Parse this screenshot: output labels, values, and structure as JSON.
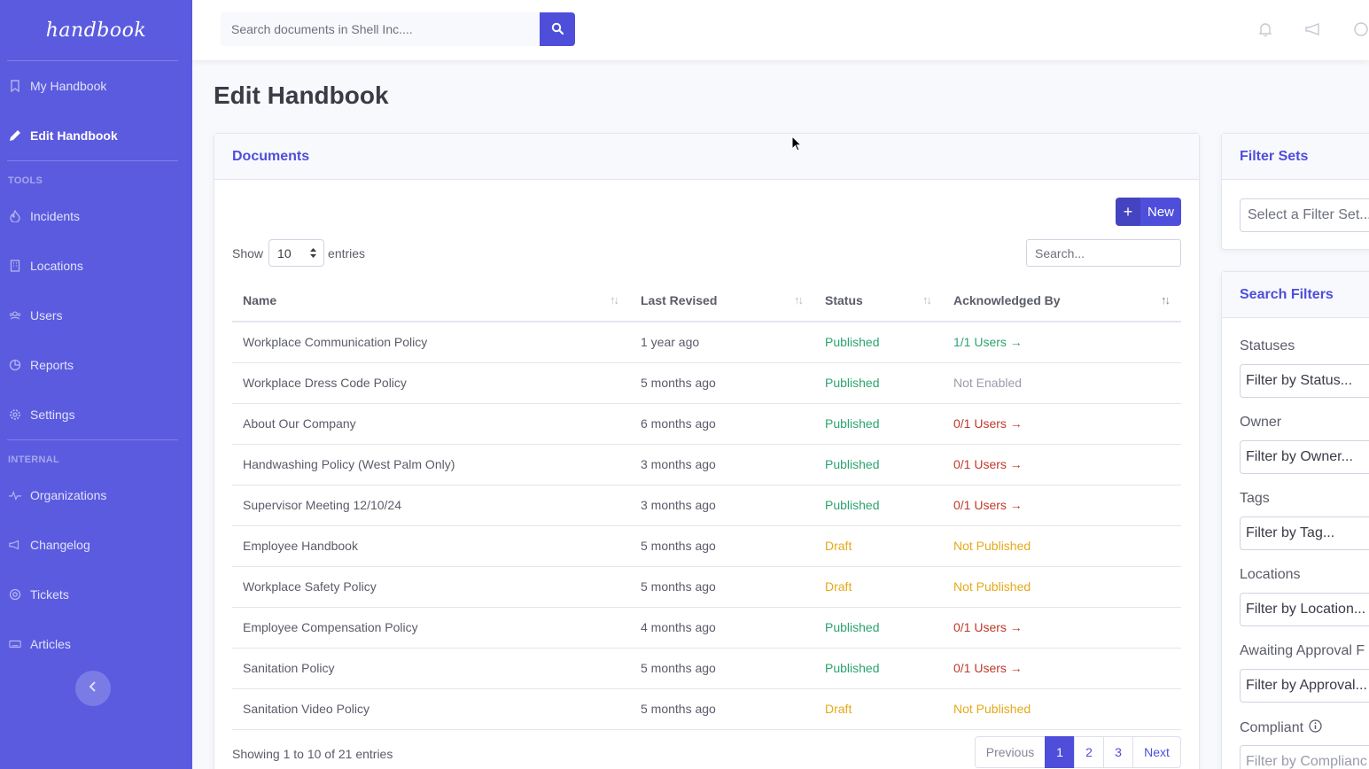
{
  "sidebar": {
    "brand": "handbook",
    "items": [
      {
        "label": "My Handbook",
        "icon": "bookmark-icon"
      },
      {
        "label": "Edit Handbook",
        "icon": "pencil-icon"
      }
    ],
    "tools_heading": "TOOLS",
    "tools": [
      {
        "label": "Incidents",
        "icon": "fire-icon"
      },
      {
        "label": "Locations",
        "icon": "building-icon"
      },
      {
        "label": "Users",
        "icon": "users-icon"
      },
      {
        "label": "Reports",
        "icon": "chart-pie-icon"
      },
      {
        "label": "Settings",
        "icon": "gear-icon"
      }
    ],
    "internal_heading": "INTERNAL",
    "internal": [
      {
        "label": "Organizations",
        "icon": "heartbeat-icon"
      },
      {
        "label": "Changelog",
        "icon": "megaphone-icon"
      },
      {
        "label": "Tickets",
        "icon": "lifebuoy-icon"
      },
      {
        "label": "Articles",
        "icon": "keyboard-icon"
      }
    ]
  },
  "topbar": {
    "search_placeholder": "Search documents in Shell Inc...."
  },
  "page": {
    "title": "Edit Handbook"
  },
  "documents": {
    "header": "Documents",
    "new_label": "New",
    "show_label": "Show",
    "entries_value": "10",
    "entries_label": "entries",
    "search_placeholder": "Search...",
    "columns": [
      "Name",
      "Last Revised",
      "Status",
      "Acknowledged By"
    ],
    "rows": [
      {
        "name": "Workplace Communication Policy",
        "revised": "1 year ago",
        "status": "Published",
        "ack": "1/1 Users →"
      },
      {
        "name": "Workplace Dress Code Policy",
        "revised": "5 months ago",
        "status": "Published",
        "ack": "Not Enabled"
      },
      {
        "name": "About Our Company",
        "revised": "6 months ago",
        "status": "Published",
        "ack": "0/1 Users →"
      },
      {
        "name": "Handwashing Policy (West Palm Only)",
        "revised": "3 months ago",
        "status": "Published",
        "ack": "0/1 Users →"
      },
      {
        "name": "Supervisor Meeting 12/10/24",
        "revised": "3 months ago",
        "status": "Published",
        "ack": "0/1 Users →"
      },
      {
        "name": "Employee Handbook",
        "revised": "5 months ago",
        "status": "Draft",
        "ack": "Not Published"
      },
      {
        "name": "Workplace Safety Policy",
        "revised": "5 months ago",
        "status": "Draft",
        "ack": "Not Published"
      },
      {
        "name": "Employee Compensation Policy",
        "revised": "4 months ago",
        "status": "Published",
        "ack": "0/1 Users →"
      },
      {
        "name": "Sanitation Policy",
        "revised": "5 months ago",
        "status": "Published",
        "ack": "0/1 Users →"
      },
      {
        "name": "Sanitation Video Policy",
        "revised": "5 months ago",
        "status": "Draft",
        "ack": "Not Published"
      }
    ],
    "showing": "Showing 1 to 10 of 21 entries",
    "pager": {
      "previous": "Previous",
      "pages": [
        "1",
        "2",
        "3"
      ],
      "next": "Next"
    }
  },
  "filter_sets": {
    "header": "Filter Sets",
    "placeholder": "Select a Filter Set..."
  },
  "search_filters": {
    "header": "Search Filters",
    "fields": [
      {
        "label": "Statuses",
        "placeholder": "Filter by Status..."
      },
      {
        "label": "Owner",
        "placeholder": "Filter by Owner..."
      },
      {
        "label": "Tags",
        "placeholder": "Filter by Tag..."
      },
      {
        "label": "Locations",
        "placeholder": "Filter by Location..."
      },
      {
        "label": "Awaiting Approval F",
        "placeholder": "Filter by Approval..."
      },
      {
        "label": "Compliant",
        "placeholder": "Filter by Complianc"
      }
    ]
  }
}
